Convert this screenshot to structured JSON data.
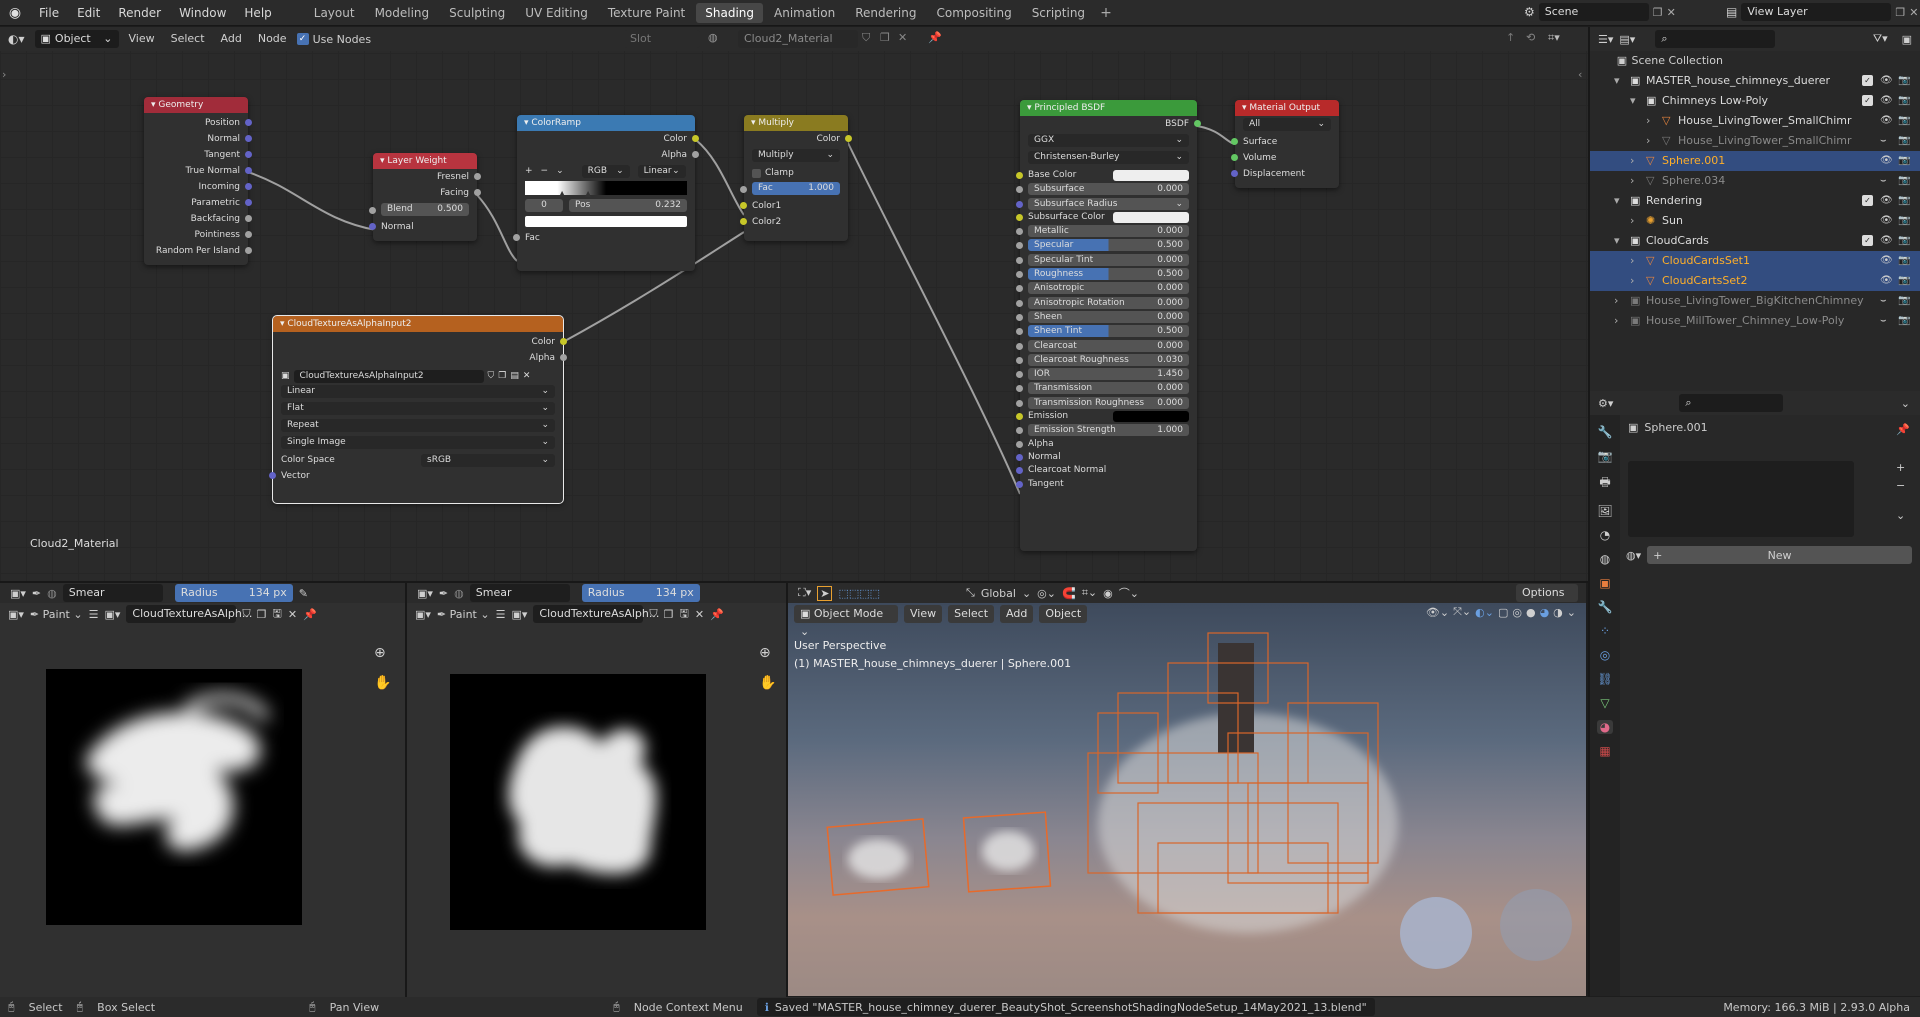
{
  "topbar": {
    "menus": [
      "File",
      "Edit",
      "Render",
      "Window",
      "Help"
    ],
    "workspaces": [
      "Layout",
      "Modeling",
      "Sculpting",
      "UV Editing",
      "Texture Paint",
      "Shading",
      "Animation",
      "Rendering",
      "Compositing",
      "Scripting"
    ],
    "active_workspace": "Shading",
    "scene": "Scene",
    "view_layer": "View Layer"
  },
  "node_header": {
    "mode": "Object",
    "menus": [
      "View",
      "Select",
      "Add",
      "Node"
    ],
    "use_nodes": "Use Nodes",
    "slot": "Slot",
    "material": "Cloud2_Material"
  },
  "node_editor_label": "Cloud2_Material",
  "nodes": {
    "geometry": {
      "title": "Geometry",
      "outputs": [
        "Position",
        "Normal",
        "Tangent",
        "True Normal",
        "Incoming",
        "Parametric",
        "Backfacing",
        "Pointiness",
        "Random Per Island"
      ]
    },
    "layer_weight": {
      "title": "Layer Weight",
      "outputs": [
        "Fresnel",
        "Facing"
      ],
      "blend_label": "Blend",
      "blend": "0.500",
      "normal": "Normal"
    },
    "color_ramp": {
      "title": "ColorRamp",
      "outputs": [
        "Color",
        "Alpha"
      ],
      "mode": "RGB",
      "interp": "Linear",
      "index": "0",
      "pos_label": "Pos",
      "pos": "0.232",
      "fac": "Fac"
    },
    "multiply": {
      "title": "Multiply",
      "output": "Color",
      "op": "Multiply",
      "clamp": "Clamp",
      "fac_label": "Fac",
      "fac": "1.000",
      "inputs": [
        "Color1",
        "Color2"
      ]
    },
    "image_tex": {
      "title": "CloudTextureAsAlphaInput2",
      "outputs": [
        "Color",
        "Alpha"
      ],
      "image": "CloudTextureAsAlphaInput2",
      "interp": "Linear",
      "proj": "Flat",
      "ext": "Repeat",
      "source": "Single Image",
      "cs_label": "Color Space",
      "cs": "sRGB",
      "vector": "Vector"
    },
    "bsdf": {
      "title": "Principled BSDF",
      "output": "BSDF",
      "distribution": "GGX",
      "sss_method": "Christensen-Burley",
      "rows": [
        {
          "label": "Base Color",
          "kind": "color",
          "sock": "col"
        },
        {
          "label": "Subsurface",
          "value": "0.000",
          "kind": "slider",
          "sock": "flt"
        },
        {
          "label": "Subsurface Radius",
          "kind": "drop",
          "sock": "vec"
        },
        {
          "label": "Subsurface Color",
          "kind": "color",
          "sock": "col"
        },
        {
          "label": "Metallic",
          "value": "0.000",
          "kind": "slider",
          "sock": "flt"
        },
        {
          "label": "Specular",
          "value": "0.500",
          "kind": "slider",
          "fill": 0.5,
          "sock": "flt"
        },
        {
          "label": "Specular Tint",
          "value": "0.000",
          "kind": "slider",
          "sock": "flt"
        },
        {
          "label": "Roughness",
          "value": "0.500",
          "kind": "slider",
          "fill": 0.5,
          "sock": "flt"
        },
        {
          "label": "Anisotropic",
          "value": "0.000",
          "kind": "slider",
          "sock": "flt"
        },
        {
          "label": "Anisotropic Rotation",
          "value": "0.000",
          "kind": "slider",
          "sock": "flt"
        },
        {
          "label": "Sheen",
          "value": "0.000",
          "kind": "slider",
          "sock": "flt"
        },
        {
          "label": "Sheen Tint",
          "value": "0.500",
          "kind": "slider",
          "fill": 0.5,
          "sock": "flt"
        },
        {
          "label": "Clearcoat",
          "value": "0.000",
          "kind": "slider",
          "sock": "flt"
        },
        {
          "label": "Clearcoat Roughness",
          "value": "0.030",
          "kind": "slider",
          "sock": "flt"
        },
        {
          "label": "IOR",
          "value": "1.450",
          "kind": "slider",
          "sock": "flt"
        },
        {
          "label": "Transmission",
          "value": "0.000",
          "kind": "slider",
          "sock": "flt"
        },
        {
          "label": "Transmission Roughness",
          "value": "0.000",
          "kind": "slider",
          "sock": "flt"
        },
        {
          "label": "Emission",
          "kind": "color-dark",
          "sock": "col"
        },
        {
          "label": "Emission Strength",
          "value": "1.000",
          "kind": "slider",
          "sock": "flt"
        },
        {
          "label": "Alpha",
          "kind": "plain",
          "sock": "flt"
        },
        {
          "label": "Normal",
          "kind": "plain",
          "sock": "vec"
        },
        {
          "label": "Clearcoat Normal",
          "kind": "plain",
          "sock": "vec"
        },
        {
          "label": "Tangent",
          "kind": "plain",
          "sock": "vec"
        }
      ]
    },
    "output": {
      "title": "Material Output",
      "target": "All",
      "inputs": [
        "Surface",
        "Volume",
        "Displacement"
      ]
    }
  },
  "outliner": {
    "root": "Scene Collection",
    "rows": [
      {
        "label": "MASTER_house_chimneys_duerer",
        "indent": 1,
        "type": "coll",
        "open": true,
        "check": true
      },
      {
        "label": "Chimneys Low-Poly",
        "indent": 2,
        "type": "coll",
        "open": true,
        "check": true
      },
      {
        "label": "House_LivingTower_SmallChimr",
        "indent": 3,
        "type": "mesh"
      },
      {
        "label": "House_LivingTower_SmallChimr",
        "indent": 3,
        "type": "mesh",
        "dim": true
      },
      {
        "label": "Sphere.001",
        "indent": 2,
        "type": "mesh",
        "sel": true,
        "active": true
      },
      {
        "label": "Sphere.034",
        "indent": 2,
        "type": "mesh",
        "dim": true
      },
      {
        "label": "Rendering",
        "indent": 1,
        "type": "coll",
        "open": true,
        "check": true
      },
      {
        "label": "Sun",
        "indent": 2,
        "type": "light"
      },
      {
        "label": "CloudCards",
        "indent": 1,
        "type": "coll",
        "open": true,
        "check": true
      },
      {
        "label": "CloudCardsSet1",
        "indent": 2,
        "type": "mesh",
        "sel": true
      },
      {
        "label": "CloudCartsSet2",
        "indent": 2,
        "type": "mesh",
        "sel": true
      },
      {
        "label": "House_LivingTower_BigKitchenChimney",
        "indent": 1,
        "type": "coll",
        "dim": true
      },
      {
        "label": "House_MillTower_Chimney_Low-Poly",
        "indent": 1,
        "type": "coll",
        "dim": true
      }
    ]
  },
  "properties": {
    "object": "Sphere.001",
    "new_label": "New"
  },
  "image_editor_1": {
    "brush": "Smear",
    "radius_label": "Radius",
    "radius": "134 px",
    "mode": "Paint",
    "image": "CloudTextureAsAlph..."
  },
  "image_editor_2": {
    "brush": "Smear",
    "radius_label": "Radius",
    "radius": "134 px",
    "mode": "Paint",
    "image": "CloudTextureAsAlph..."
  },
  "viewport": {
    "mode": "Object Mode",
    "menus": [
      "View",
      "Select",
      "Add",
      "Object"
    ],
    "orientation": "Global",
    "options": "Options",
    "perspective": "User Perspective",
    "info": "(1) MASTER_house_chimneys_duerer | Sphere.001"
  },
  "status": {
    "select": "Select",
    "box_select": "Box Select",
    "pan": "Pan View",
    "context": "Node Context Menu",
    "saved": "Saved \"MASTER_house_chimney_duerer_BeautyShot_ScreenshotShadingNodeSetup_14May2021_13.blend\"",
    "memory": "Memory: 166.3 MiB | 2.93.0 Alpha"
  },
  "colors": {
    "accent": "#4772b3",
    "selection": "#334d80",
    "orange": "#e87d3e",
    "geometry_header": "#a12c3a",
    "input_header": "#b8343f",
    "converter_header": "#3b7ab3",
    "color_header": "#8a7b20",
    "texture_header": "#b5611f",
    "shader_header": "#3b9a3b",
    "output_header": "#b82a2a"
  }
}
